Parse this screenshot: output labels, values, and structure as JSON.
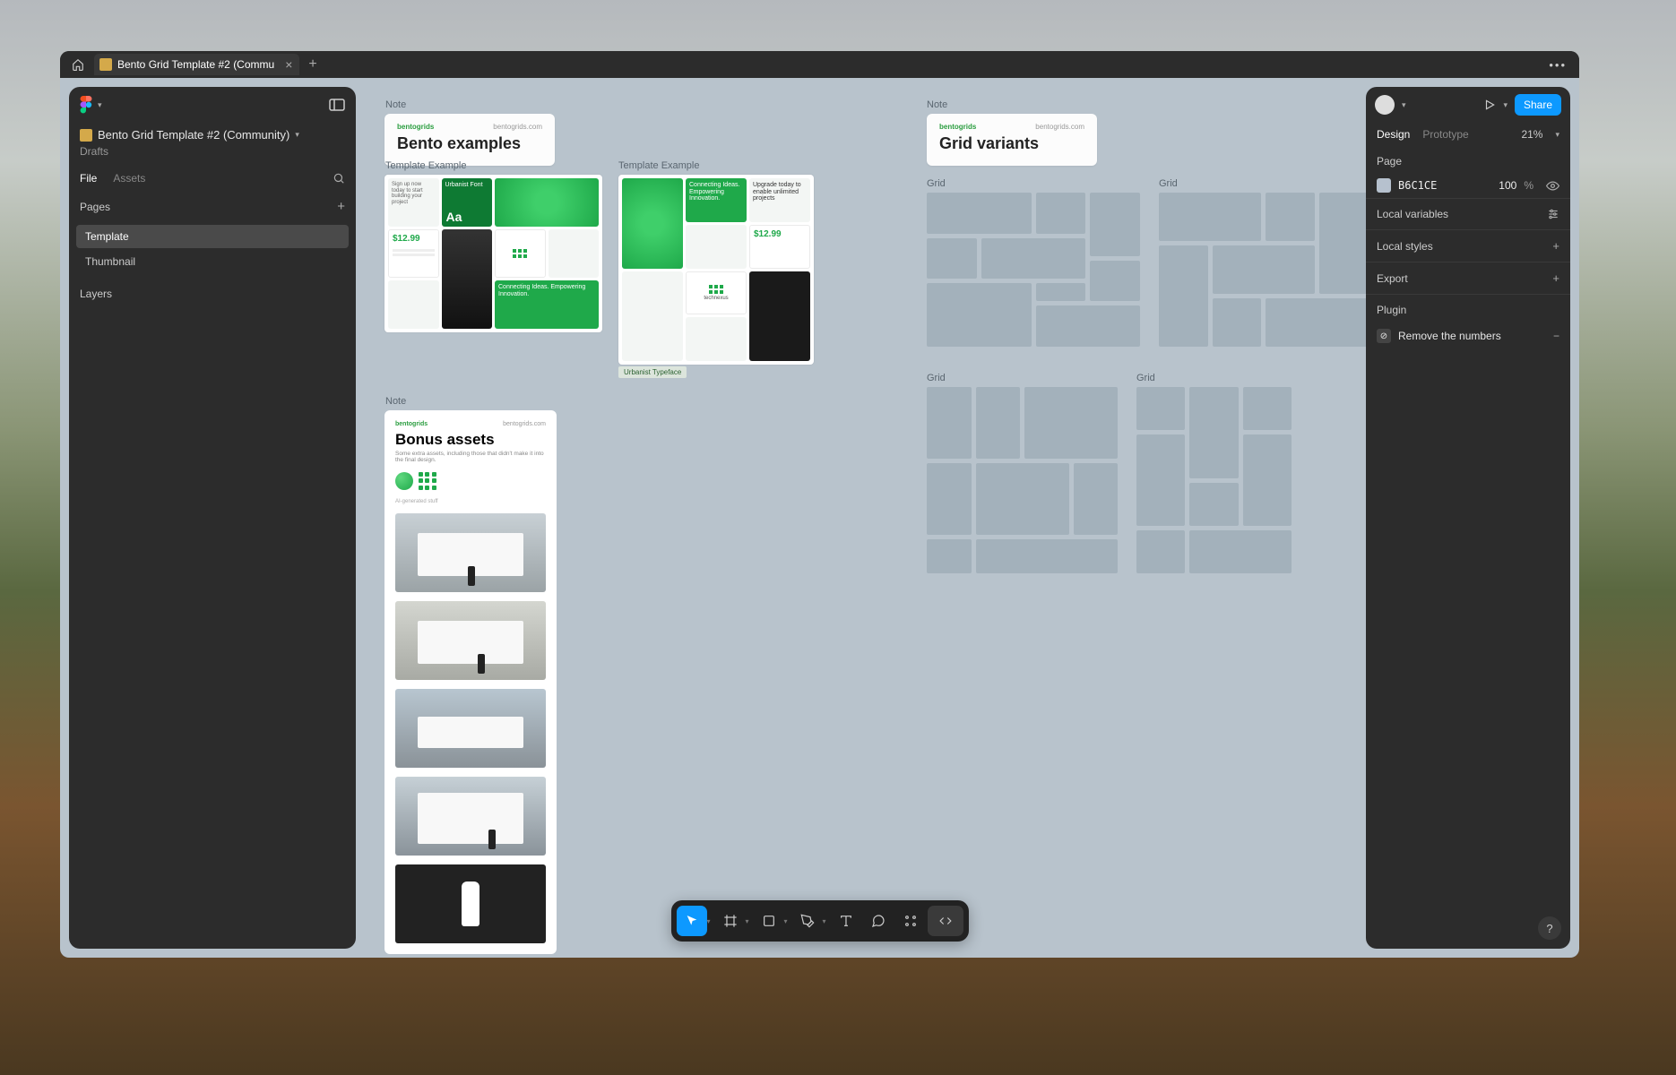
{
  "titlebar": {
    "tab_label": "Bento Grid Template #2 (Commu"
  },
  "left": {
    "file_title": "Bento Grid Template #2 (Community)",
    "drafts": "Drafts",
    "tab_file": "File",
    "tab_assets": "Assets",
    "pages_hdr": "Pages",
    "pages": {
      "template": "Template",
      "thumbnail": "Thumbnail"
    },
    "layers_hdr": "Layers"
  },
  "canvas": {
    "labels": {
      "note1": "Note",
      "note2": "Note",
      "note3": "Note",
      "tmpl1": "Template Example",
      "tmpl2": "Template Example",
      "grid1": "Grid",
      "grid2": "Grid",
      "grid3": "Grid",
      "grid4": "Grid"
    },
    "note1": {
      "brand": "bentogrids",
      "site": "bentogrids.com",
      "title": "Bento examples"
    },
    "note2": {
      "brand": "bentogrids",
      "site": "bentogrids.com",
      "title": "Grid variants"
    },
    "bonus": {
      "brand": "bentogrids",
      "site": "bentogrids.com",
      "title": "Bonus assets",
      "sub": "Some extra assets, including those that didn't make it into the final design.",
      "tiny": "AI-generated stuff"
    },
    "bento": {
      "font_title": "Urbanist Font",
      "font_aa": "Aa",
      "price": "$12.99",
      "tagline": "Connecting Ideas. Empowering Innovation.",
      "brand": "technexus",
      "upgrade": "Upgrade today to enable unlimited projects",
      "typeface": "Urbanist Typeface"
    }
  },
  "right": {
    "tabs": {
      "design": "Design",
      "prototype": "Prototype"
    },
    "zoom": "21%",
    "share": "Share",
    "page_hdr": "Page",
    "color_hex": "B6C1CE",
    "color_val": "100",
    "color_pct": "%",
    "local_vars": "Local variables",
    "local_styles": "Local styles",
    "export": "Export",
    "plugin_hdr": "Plugin",
    "plugin_name": "Remove the numbers"
  }
}
